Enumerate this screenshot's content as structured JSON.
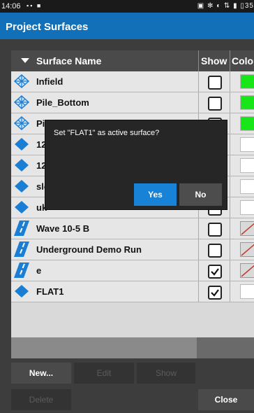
{
  "status_bar": {
    "time": "14:06",
    "left_icons": "▪▪ ■",
    "right_icons": "▣ ✻ ◐ ⇅ ▮ ▯35"
  },
  "header": {
    "title": "Project Surfaces"
  },
  "table": {
    "columns": [
      "Surface Name",
      "Show",
      "Colo"
    ],
    "rows": [
      {
        "name": "Infield",
        "icon": "grid-diamond-icon",
        "show": false,
        "color": "#19e619"
      },
      {
        "name": "Pile_Bottom",
        "icon": "grid-diamond-icon",
        "show": false,
        "color": "#19e619"
      },
      {
        "name": "Pi",
        "icon": "grid-diamond-icon",
        "show": false,
        "color": "#19e619"
      },
      {
        "name": "123",
        "icon": "solid-diamond-icon",
        "show": false,
        "color": "#ffffff"
      },
      {
        "name": "1229",
        "icon": "solid-diamond-icon",
        "show": false,
        "color": "#ffffff"
      },
      {
        "name": "slope",
        "icon": "solid-diamond-icon",
        "show": false,
        "color": "#ffffff"
      },
      {
        "name": "uk",
        "icon": "solid-diamond-icon",
        "show": false,
        "color": "#ffffff"
      },
      {
        "name": "Wave 10-5 B",
        "icon": "road-icon",
        "show": false,
        "color": "none"
      },
      {
        "name": "Underground Demo Run",
        "icon": "road-icon",
        "show": false,
        "color": "none"
      },
      {
        "name": "e",
        "icon": "road-icon",
        "show": true,
        "color": "none"
      },
      {
        "name": "FLAT1",
        "icon": "solid-diamond-icon",
        "show": true,
        "color": "#ffffff"
      }
    ]
  },
  "dialog": {
    "message": "Set \"FLAT1\" as active surface?",
    "yes_label": "Yes",
    "no_label": "No"
  },
  "buttons": {
    "new": "New...",
    "edit": "Edit",
    "show": "Show",
    "delete": "Delete",
    "close": "Close"
  },
  "colors": {
    "header": "#1170b8",
    "accent": "#1782d6",
    "icon_blue": "#1a7fd4"
  }
}
